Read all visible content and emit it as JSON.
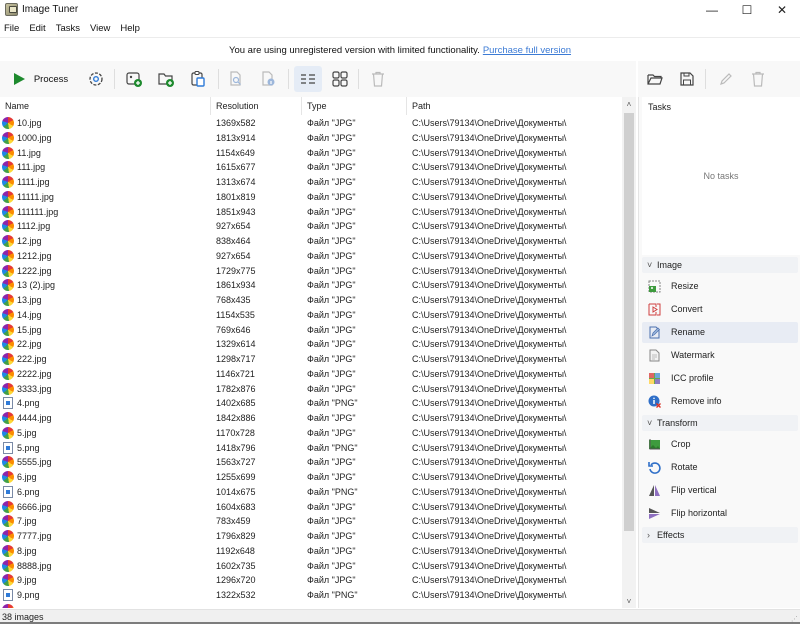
{
  "window": {
    "title": "Image Tuner",
    "controls": {
      "minimize": "—",
      "maximize": "☐",
      "close": "✕"
    }
  },
  "menu": [
    "File",
    "Edit",
    "Tasks",
    "View",
    "Help"
  ],
  "notice": {
    "text": "You are using unregistered version with limited functionality.",
    "link": "Purchase full version"
  },
  "toolbar": {
    "process_label": "Process",
    "icons": [
      "play-icon",
      "settings-icon",
      "add-image-icon",
      "add-folder-icon",
      "paste-icon",
      "preview-icon",
      "info-icon",
      "list-view-icon",
      "grid-view-icon",
      "delete-icon"
    ],
    "active_view": "list"
  },
  "right_toolbar": {
    "icons": [
      "open-folder-icon",
      "save-icon",
      "edit-icon",
      "delete-icon"
    ]
  },
  "list": {
    "columns": [
      "Name",
      "Resolution",
      "Type",
      "Path"
    ],
    "rows": [
      {
        "name": "10.jpg",
        "res": "1369x582",
        "type": "Файл \"JPG\"",
        "path": "C:\\Users\\79134\\OneDrive\\Документы\\",
        "kind": "jpg"
      },
      {
        "name": "1000.jpg",
        "res": "1813x914",
        "type": "Файл \"JPG\"",
        "path": "C:\\Users\\79134\\OneDrive\\Документы\\",
        "kind": "jpg"
      },
      {
        "name": "11.jpg",
        "res": "1154x649",
        "type": "Файл \"JPG\"",
        "path": "C:\\Users\\79134\\OneDrive\\Документы\\",
        "kind": "jpg"
      },
      {
        "name": "111.jpg",
        "res": "1615x677",
        "type": "Файл \"JPG\"",
        "path": "C:\\Users\\79134\\OneDrive\\Документы\\",
        "kind": "jpg"
      },
      {
        "name": "1111.jpg",
        "res": "1313x674",
        "type": "Файл \"JPG\"",
        "path": "C:\\Users\\79134\\OneDrive\\Документы\\",
        "kind": "jpg"
      },
      {
        "name": "11111.jpg",
        "res": "1801x819",
        "type": "Файл \"JPG\"",
        "path": "C:\\Users\\79134\\OneDrive\\Документы\\",
        "kind": "jpg"
      },
      {
        "name": "111111.jpg",
        "res": "1851x943",
        "type": "Файл \"JPG\"",
        "path": "C:\\Users\\79134\\OneDrive\\Документы\\",
        "kind": "jpg"
      },
      {
        "name": "1112.jpg",
        "res": "927x654",
        "type": "Файл \"JPG\"",
        "path": "C:\\Users\\79134\\OneDrive\\Документы\\",
        "kind": "jpg"
      },
      {
        "name": "12.jpg",
        "res": "838x464",
        "type": "Файл \"JPG\"",
        "path": "C:\\Users\\79134\\OneDrive\\Документы\\",
        "kind": "jpg"
      },
      {
        "name": "1212.jpg",
        "res": "927x654",
        "type": "Файл \"JPG\"",
        "path": "C:\\Users\\79134\\OneDrive\\Документы\\",
        "kind": "jpg"
      },
      {
        "name": "1222.jpg",
        "res": "1729x775",
        "type": "Файл \"JPG\"",
        "path": "C:\\Users\\79134\\OneDrive\\Документы\\",
        "kind": "jpg"
      },
      {
        "name": "13 (2).jpg",
        "res": "1861x934",
        "type": "Файл \"JPG\"",
        "path": "C:\\Users\\79134\\OneDrive\\Документы\\",
        "kind": "jpg"
      },
      {
        "name": "13.jpg",
        "res": "768x435",
        "type": "Файл \"JPG\"",
        "path": "C:\\Users\\79134\\OneDrive\\Документы\\",
        "kind": "jpg"
      },
      {
        "name": "14.jpg",
        "res": "1154x535",
        "type": "Файл \"JPG\"",
        "path": "C:\\Users\\79134\\OneDrive\\Документы\\",
        "kind": "jpg"
      },
      {
        "name": "15.jpg",
        "res": "769x646",
        "type": "Файл \"JPG\"",
        "path": "C:\\Users\\79134\\OneDrive\\Документы\\",
        "kind": "jpg"
      },
      {
        "name": "22.jpg",
        "res": "1329x614",
        "type": "Файл \"JPG\"",
        "path": "C:\\Users\\79134\\OneDrive\\Документы\\",
        "kind": "jpg"
      },
      {
        "name": "222.jpg",
        "res": "1298x717",
        "type": "Файл \"JPG\"",
        "path": "C:\\Users\\79134\\OneDrive\\Документы\\",
        "kind": "jpg"
      },
      {
        "name": "2222.jpg",
        "res": "1146x721",
        "type": "Файл \"JPG\"",
        "path": "C:\\Users\\79134\\OneDrive\\Документы\\",
        "kind": "jpg"
      },
      {
        "name": "3333.jpg",
        "res": "1782x876",
        "type": "Файл \"JPG\"",
        "path": "C:\\Users\\79134\\OneDrive\\Документы\\",
        "kind": "jpg"
      },
      {
        "name": "4.png",
        "res": "1402x685",
        "type": "Файл \"PNG\"",
        "path": "C:\\Users\\79134\\OneDrive\\Документы\\",
        "kind": "png"
      },
      {
        "name": "4444.jpg",
        "res": "1842x886",
        "type": "Файл \"JPG\"",
        "path": "C:\\Users\\79134\\OneDrive\\Документы\\",
        "kind": "jpg"
      },
      {
        "name": "5.jpg",
        "res": "1170x728",
        "type": "Файл \"JPG\"",
        "path": "C:\\Users\\79134\\OneDrive\\Документы\\",
        "kind": "jpg"
      },
      {
        "name": "5.png",
        "res": "1418x796",
        "type": "Файл \"PNG\"",
        "path": "C:\\Users\\79134\\OneDrive\\Документы\\",
        "kind": "png"
      },
      {
        "name": "5555.jpg",
        "res": "1563x727",
        "type": "Файл \"JPG\"",
        "path": "C:\\Users\\79134\\OneDrive\\Документы\\",
        "kind": "jpg"
      },
      {
        "name": "6.jpg",
        "res": "1255x699",
        "type": "Файл \"JPG\"",
        "path": "C:\\Users\\79134\\OneDrive\\Документы\\",
        "kind": "jpg"
      },
      {
        "name": "6.png",
        "res": "1014x675",
        "type": "Файл \"PNG\"",
        "path": "C:\\Users\\79134\\OneDrive\\Документы\\",
        "kind": "png"
      },
      {
        "name": "6666.jpg",
        "res": "1604x683",
        "type": "Файл \"JPG\"",
        "path": "C:\\Users\\79134\\OneDrive\\Документы\\",
        "kind": "jpg"
      },
      {
        "name": "7.jpg",
        "res": "783x459",
        "type": "Файл \"JPG\"",
        "path": "C:\\Users\\79134\\OneDrive\\Документы\\",
        "kind": "jpg"
      },
      {
        "name": "7777.jpg",
        "res": "1796x829",
        "type": "Файл \"JPG\"",
        "path": "C:\\Users\\79134\\OneDrive\\Документы\\",
        "kind": "jpg"
      },
      {
        "name": "8.jpg",
        "res": "1192x648",
        "type": "Файл \"JPG\"",
        "path": "C:\\Users\\79134\\OneDrive\\Документы\\",
        "kind": "jpg"
      },
      {
        "name": "8888.jpg",
        "res": "1602x735",
        "type": "Файл \"JPG\"",
        "path": "C:\\Users\\79134\\OneDrive\\Документы\\",
        "kind": "jpg"
      },
      {
        "name": "9.jpg",
        "res": "1296x720",
        "type": "Файл \"JPG\"",
        "path": "C:\\Users\\79134\\OneDrive\\Документы\\",
        "kind": "jpg"
      },
      {
        "name": "9.png",
        "res": "1322x532",
        "type": "Файл \"PNG\"",
        "path": "C:\\Users\\79134\\OneDrive\\Документы\\",
        "kind": "png"
      }
    ]
  },
  "right_panel": {
    "tasks_title": "Tasks",
    "empty_text": "No tasks",
    "sections": [
      {
        "label": "Image",
        "expanded": true,
        "items": [
          {
            "label": "Resize",
            "icon": "resize-icon"
          },
          {
            "label": "Convert",
            "icon": "convert-icon"
          },
          {
            "label": "Rename",
            "icon": "rename-icon",
            "highlighted": true
          },
          {
            "label": "Watermark",
            "icon": "watermark-icon"
          },
          {
            "label": "ICC profile",
            "icon": "icc-profile-icon"
          },
          {
            "label": "Remove info",
            "icon": "remove-info-icon"
          }
        ]
      },
      {
        "label": "Transform",
        "expanded": true,
        "items": [
          {
            "label": "Crop",
            "icon": "crop-icon"
          },
          {
            "label": "Rotate",
            "icon": "rotate-icon"
          },
          {
            "label": "Flip vertical",
            "icon": "flip-vertical-icon"
          },
          {
            "label": "Flip horizontal",
            "icon": "flip-horizontal-icon"
          }
        ]
      },
      {
        "label": "Effects",
        "expanded": false,
        "items": []
      }
    ]
  },
  "status": {
    "count_text": "38 images"
  },
  "colors": {
    "link": "#3c7bd5",
    "process_green": "#1e8a2e",
    "highlight": "#e8ecf4",
    "active_view": "#e5ecf6"
  }
}
